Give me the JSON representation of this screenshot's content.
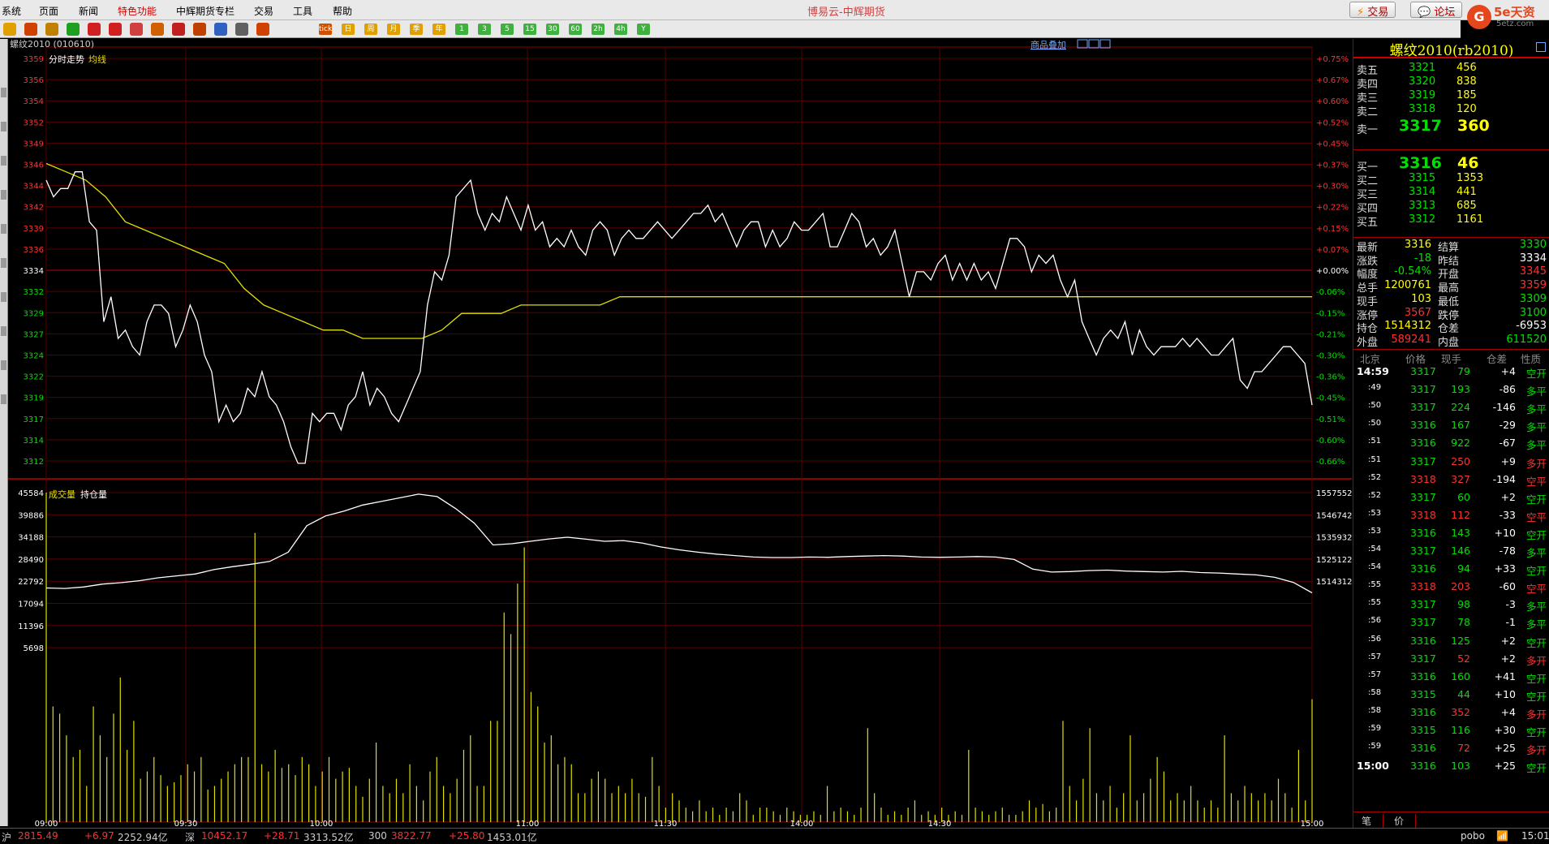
{
  "menu": [
    "系统",
    "页面",
    "新闻",
    "特色功能",
    "中辉期货专栏",
    "交易",
    "工具",
    "帮助"
  ],
  "app_title": "博易云-中辉期货",
  "top_buttons": {
    "trade": "交易",
    "forum": "论坛"
  },
  "logo": {
    "text": "5e天资",
    "sub": "5etz.com"
  },
  "toolbar_icons": [
    "arrow-icon",
    "home-icon",
    "book-icon",
    "refresh-icon",
    "zoom-in-icon",
    "zoom-out-icon",
    "window-icon",
    "pen-icon",
    "color-icon",
    "filter-icon",
    "chart-icon",
    "table-icon",
    "draw-icon"
  ],
  "toolbar_periods": [
    "tick",
    "日",
    "周",
    "月",
    "季",
    "年",
    "1",
    "3",
    "5",
    "15",
    "30",
    "60",
    "2h",
    "4h",
    "Y"
  ],
  "chart_header": {
    "symbol": "螺纹2010 (010610)",
    "overlay_link": "商品叠加"
  },
  "main_legend": {
    "line1": "分时走势",
    "line2": "均线"
  },
  "volume_legend": {
    "line1": "成交量",
    "line2": "持仓量"
  },
  "chart_data": {
    "type": "line",
    "price_axis_labels": [
      "3359",
      "3356",
      "3354",
      "3352",
      "3349",
      "3346",
      "3344",
      "3342",
      "3339",
      "3336",
      "3334",
      "3332",
      "3329",
      "3327",
      "3324",
      "3322",
      "3319",
      "3317",
      "3314",
      "3312"
    ],
    "pct_axis_labels": [
      "+0.75%",
      "+0.67%",
      "+0.60%",
      "+0.52%",
      "+0.45%",
      "+0.37%",
      "+0.30%",
      "+0.22%",
      "+0.15%",
      "+0.07%",
      "+0.00%",
      "-0.06%",
      "-0.15%",
      "-0.21%",
      "-0.30%",
      "-0.36%",
      "-0.45%",
      "-0.51%",
      "-0.60%",
      "-0.66%"
    ],
    "volume_axis_labels": [
      "45584",
      "39886",
      "34188",
      "28490",
      "22792",
      "17094",
      "11396",
      "5698"
    ],
    "oi_axis_labels": [
      "1557552",
      "1546742",
      "1535932",
      "1525122",
      "1514312"
    ],
    "time_labels": [
      "09:00",
      "09:30",
      "10:00",
      "11:00",
      "11:30",
      "14:00",
      "14:30",
      "15:00"
    ],
    "price_range": [
      3310.6,
      3360.3
    ],
    "prev_settle": 3334,
    "price_series": [
      3345,
      3343,
      3344,
      3344,
      3346,
      3346,
      3340,
      3339,
      3328,
      3331,
      3326,
      3327,
      3325,
      3324,
      3328,
      3330,
      3330,
      3329,
      3325,
      3327,
      3330,
      3328,
      3324,
      3322,
      3316,
      3318,
      3316,
      3317,
      3320,
      3319,
      3322,
      3319,
      3318,
      3316,
      3313,
      3311,
      3311,
      3317,
      3316,
      3317,
      3317,
      3315,
      3318,
      3319,
      3322,
      3318,
      3320,
      3319,
      3317,
      3316,
      3318,
      3320,
      3322,
      3330,
      3334,
      3333,
      3336,
      3343,
      3344,
      3345,
      3341,
      3339,
      3341,
      3340,
      3343,
      3341,
      3339,
      3342,
      3339,
      3340,
      3337,
      3338,
      3337,
      3339,
      3337,
      3336,
      3339,
      3340,
      3339,
      3336,
      3338,
      3339,
      3338,
      3338,
      3339,
      3340,
      3339,
      3338,
      3339,
      3340,
      3341,
      3341,
      3342,
      3340,
      3341,
      3339,
      3337,
      3339,
      3340,
      3340,
      3337,
      3339,
      3337,
      3338,
      3340,
      3339,
      3339,
      3340,
      3341,
      3337,
      3337,
      3339,
      3341,
      3340,
      3337,
      3338,
      3336,
      3337,
      3339,
      3335,
      3331,
      3334,
      3334,
      3333,
      3335,
      3336,
      3333,
      3335,
      3333,
      3335,
      3333,
      3334,
      3332,
      3335,
      3338,
      3338,
      3337,
      3334,
      3336,
      3335,
      3336,
      3333,
      3331,
      3333,
      3328,
      3326,
      3324,
      3326,
      3327,
      3326,
      3328,
      3324,
      3327,
      3325,
      3324,
      3325,
      3325,
      3325,
      3326,
      3325,
      3326,
      3325,
      3324,
      3324,
      3325,
      3326,
      3321,
      3320,
      3322,
      3322,
      3323,
      3324,
      3325,
      3325,
      3324,
      3323,
      3318
    ],
    "avg_series": [
      3347,
      3346,
      3345,
      3343,
      3340,
      3339,
      3338,
      3337,
      3336,
      3335,
      3332,
      3330,
      3329,
      3328,
      3327,
      3327,
      3326,
      3326,
      3326,
      3326,
      3327,
      3329,
      3329,
      3329,
      3330,
      3330,
      3330,
      3330,
      3330,
      3331,
      3331,
      3331,
      3331,
      3331,
      3331,
      3331,
      3331,
      3331,
      3331,
      3331,
      3331,
      3331,
      3331,
      3331,
      3331,
      3331,
      3331,
      3331,
      3331,
      3331,
      3331,
      3331,
      3331,
      3331,
      3331,
      3331,
      3331,
      3331,
      3331,
      3331,
      3331,
      3331,
      3331,
      3331,
      3331
    ],
    "oi_range": [
      1512000,
      1560000
    ],
    "oi_series": [
      1518200,
      1518000,
      1518600,
      1519800,
      1520400,
      1521200,
      1522400,
      1523200,
      1524000,
      1525800,
      1527000,
      1528000,
      1529200,
      1533000,
      1544000,
      1548000,
      1550000,
      1552500,
      1554000,
      1555500,
      1557000,
      1556000,
      1551000,
      1545000,
      1536000,
      1536500,
      1537500,
      1538500,
      1539200,
      1538400,
      1537500,
      1537800,
      1536800,
      1535200,
      1534000,
      1533000,
      1532200,
      1531600,
      1531000,
      1530800,
      1530800,
      1531000,
      1530900,
      1531200,
      1531400,
      1531600,
      1531400,
      1531000,
      1530900,
      1531000,
      1531200,
      1531000,
      1530000,
      1526000,
      1524800,
      1525000,
      1525400,
      1525600,
      1525200,
      1525000,
      1524800,
      1525100,
      1524600,
      1524400,
      1524000,
      1523600,
      1522600,
      1520500,
      1516200
    ],
    "volume_bars": [
      45584,
      16000,
      15000,
      12000,
      9000,
      10000,
      5000,
      16000,
      12000,
      9000,
      15000,
      20000,
      10000,
      14000,
      6000,
      7000,
      9000,
      6500,
      5000,
      5500,
      6500,
      8000,
      7000,
      9000,
      4500,
      5000,
      6000,
      7000,
      8000,
      9000,
      9000,
      40000,
      8000,
      7000,
      10000,
      7500,
      8000,
      6500,
      9000,
      8000,
      5000,
      7000,
      9000,
      6000,
      7000,
      7500,
      5000,
      3500,
      6000,
      11000,
      5000,
      4000,
      6000,
      4000,
      8000,
      5000,
      3000,
      7000,
      9000,
      5000,
      4000,
      6000,
      10000,
      12000,
      5000,
      5000,
      14000,
      14000,
      29000,
      26000,
      33000,
      38000,
      18000,
      16000,
      11000,
      12000,
      8000,
      9000,
      8000,
      4000,
      4000,
      6000,
      7000,
      6000,
      4000,
      5000,
      4000,
      6000,
      4000,
      3500,
      9000,
      5000,
      2000,
      4000,
      3000,
      2000,
      1500,
      3000,
      1500,
      2000,
      1000,
      2000,
      1500,
      4000,
      3000,
      1000,
      2000,
      2000,
      1500,
      1000,
      2000,
      1500,
      1000,
      1000,
      1500,
      1000,
      5000,
      1500,
      2000,
      1500,
      1000,
      2000,
      13000,
      4000,
      2000,
      1000,
      1500,
      1000,
      2000,
      3000,
      1000,
      1500,
      1000,
      2000,
      1000,
      1500,
      1000,
      10000,
      2000,
      1500,
      1000,
      1500,
      2000,
      1000,
      1000,
      1500,
      3000,
      2000,
      2500,
      1500,
      2000,
      14000,
      5000,
      3000,
      6000,
      13000,
      4000,
      3000,
      5000,
      2000,
      4000,
      12000,
      3000,
      4000,
      6000,
      9000,
      7000,
      3000,
      4000,
      3000,
      5000,
      3000,
      2000,
      3000,
      2000,
      12000,
      4000,
      3000,
      5000,
      4000,
      3000,
      4000,
      3000,
      6000,
      4000,
      2000,
      10000,
      3000,
      17000
    ]
  },
  "quote": {
    "title": "螺纹2010(rb2010)",
    "sells": [
      {
        "label": "卖五",
        "price": "3321",
        "vol": "456"
      },
      {
        "label": "卖四",
        "price": "3320",
        "vol": "838"
      },
      {
        "label": "卖三",
        "price": "3319",
        "vol": "185"
      },
      {
        "label": "卖二",
        "price": "3318",
        "vol": "120"
      },
      {
        "label": "卖一",
        "price": "3317",
        "vol": "360"
      }
    ],
    "buys": [
      {
        "label": "买一",
        "price": "3316",
        "vol": "46"
      },
      {
        "label": "买二",
        "price": "3315",
        "vol": "1353"
      },
      {
        "label": "买三",
        "price": "3314",
        "vol": "441"
      },
      {
        "label": "买四",
        "price": "3313",
        "vol": "685"
      },
      {
        "label": "买五",
        "price": "3312",
        "vol": "1161"
      }
    ],
    "stats": [
      {
        "l1": "最新",
        "v1": "3316",
        "l2": "结算",
        "v2": "3330"
      },
      {
        "l1": "涨跌",
        "v1": "-18",
        "l2": "昨结",
        "v2": "3334"
      },
      {
        "l1": "幅度",
        "v1": "-0.54%",
        "l2": "开盘",
        "v2": "3345"
      },
      {
        "l1": "总手",
        "v1": "1200761",
        "l2": "最高",
        "v2": "3359"
      },
      {
        "l1": "现手",
        "v1": "103",
        "l2": "最低",
        "v2": "3309"
      },
      {
        "l1": "涨停",
        "v1": "3567",
        "l2": "跌停",
        "v2": "3100"
      },
      {
        "l1": "持仓",
        "v1": "1514312",
        "l2": "仓差",
        "v2": "-6953"
      },
      {
        "l1": "外盘",
        "v1": "589241",
        "l2": "内盘",
        "v2": "611520"
      }
    ],
    "tick_headers": [
      "北京",
      "价格",
      "现手",
      "仓差",
      "性质"
    ],
    "ticks": [
      {
        "t": "14:59",
        "p": "3317",
        "v": "79",
        "d": "+4",
        "k": "空开"
      },
      {
        "t": ":49",
        "p": "3317",
        "v": "193",
        "d": "-86",
        "k": "多平"
      },
      {
        "t": ":50",
        "p": "3317",
        "v": "224",
        "d": "-146",
        "k": "多平"
      },
      {
        "t": ":50",
        "p": "3316",
        "v": "167",
        "d": "-29",
        "k": "多平"
      },
      {
        "t": ":51",
        "p": "3316",
        "v": "922",
        "d": "-67",
        "k": "多平"
      },
      {
        "t": ":51",
        "p": "3317",
        "v": "250",
        "d": "+9",
        "k": "多开"
      },
      {
        "t": ":52",
        "p": "3318",
        "v": "327",
        "d": "-194",
        "k": "空平"
      },
      {
        "t": ":52",
        "p": "3317",
        "v": "60",
        "d": "+2",
        "k": "空开"
      },
      {
        "t": ":53",
        "p": "3318",
        "v": "112",
        "d": "-33",
        "k": "空平"
      },
      {
        "t": ":53",
        "p": "3316",
        "v": "143",
        "d": "+10",
        "k": "空开"
      },
      {
        "t": ":54",
        "p": "3317",
        "v": "146",
        "d": "-78",
        "k": "多平"
      },
      {
        "t": ":54",
        "p": "3316",
        "v": "94",
        "d": "+33",
        "k": "空开"
      },
      {
        "t": ":55",
        "p": "3318",
        "v": "203",
        "d": "-60",
        "k": "空平"
      },
      {
        "t": ":55",
        "p": "3317",
        "v": "98",
        "d": "-3",
        "k": "多平"
      },
      {
        "t": ":56",
        "p": "3317",
        "v": "78",
        "d": "-1",
        "k": "多平"
      },
      {
        "t": ":56",
        "p": "3316",
        "v": "125",
        "d": "+2",
        "k": "空开"
      },
      {
        "t": ":57",
        "p": "3317",
        "v": "52",
        "d": "+2",
        "k": "多开"
      },
      {
        "t": ":57",
        "p": "3316",
        "v": "160",
        "d": "+41",
        "k": "空开"
      },
      {
        "t": ":58",
        "p": "3315",
        "v": "44",
        "d": "+10",
        "k": "空开"
      },
      {
        "t": ":58",
        "p": "3316",
        "v": "352",
        "d": "+4",
        "k": "多开"
      },
      {
        "t": ":59",
        "p": "3315",
        "v": "116",
        "d": "+30",
        "k": "空开"
      },
      {
        "t": ":59",
        "p": "3316",
        "v": "72",
        "d": "+25",
        "k": "多开"
      },
      {
        "t": "15:00",
        "p": "3316",
        "v": "103",
        "d": "+25",
        "k": "空开"
      }
    ],
    "bottom_tabs": [
      "笔",
      "价"
    ]
  },
  "statusbar": {
    "sh": {
      "label": "沪",
      "val": "2815.49",
      "chg": "+6.97",
      "amt": "2252.94亿"
    },
    "sz": {
      "label": "深",
      "val": "10452.17",
      "chg": "+28.71",
      "amt": "3313.52亿"
    },
    "hs": {
      "label": "300",
      "val": "3822.77",
      "chg": "+25.80",
      "amt": "1453.01亿"
    },
    "brand": "pobo",
    "time": "15:01"
  },
  "colors": {
    "up": "#ff3030",
    "down": "#00e000",
    "grid": "#8b0000",
    "price_line": "#ffffff",
    "avg_line": "#e0e000"
  }
}
